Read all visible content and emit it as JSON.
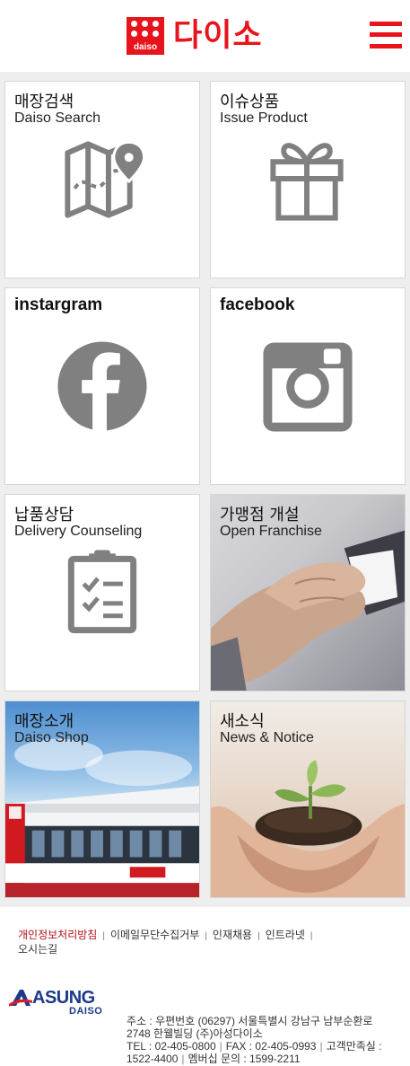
{
  "header": {
    "logo_text": "다이소",
    "logo_mark_word": "daiso",
    "brand_color": "#e8141b",
    "menu_icon": "hamburger-menu-icon"
  },
  "tiles": [
    {
      "title": "매장검색",
      "subtitle": "Daiso Search",
      "icon": "map-pin-icon"
    },
    {
      "title": "이슈상품",
      "subtitle": "Issue Product",
      "icon": "gift-icon"
    },
    {
      "title": "instargram",
      "subtitle": "",
      "icon": "facebook-icon"
    },
    {
      "title": "facebook",
      "subtitle": "",
      "icon": "instagram-icon"
    },
    {
      "title": "납품상담",
      "subtitle": "Delivery Counseling",
      "icon": "clipboard-checklist-icon"
    },
    {
      "title": "가맹점 개설",
      "subtitle": "Open Franchise",
      "icon": "handshake-photo"
    },
    {
      "title": "매장소개",
      "subtitle": "Daiso Shop",
      "icon": "store-photo"
    },
    {
      "title": "새소식",
      "subtitle": "News & Notice",
      "icon": "sprout-photo"
    }
  ],
  "footer": {
    "links": [
      "개인정보처리방침",
      "이메일무단수집거부",
      "인재채용",
      "인트라넷",
      "오시는길"
    ],
    "company_name": "ASUNG",
    "company_sub": "DAISO",
    "address_line1": "주소 : 우편번호 (06297) 서울특별시 강남구 남부순환로",
    "address_line2": "2748 한웰빌딩 (주)아성다이소",
    "tel": "TEL : 02-405-0800",
    "fax": "FAX : 02-405-0993",
    "customer_label": "고객만족실 :",
    "customer_tel": "1522-4400",
    "membership": "멤버십 문의 : 1599-2211",
    "separator": "|"
  }
}
